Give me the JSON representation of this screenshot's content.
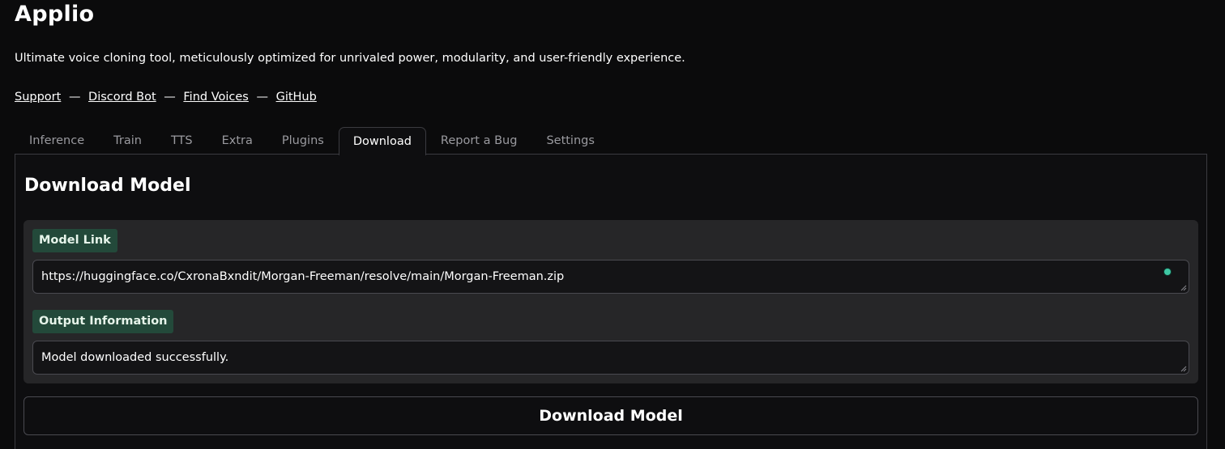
{
  "app": {
    "title": "Applio",
    "tagline": "Ultimate voice cloning tool, meticulously optimized for unrivaled power, modularity, and user-friendly experience."
  },
  "links": {
    "separator": "—",
    "items": [
      {
        "label": "Support"
      },
      {
        "label": "Discord Bot"
      },
      {
        "label": "Find Voices"
      },
      {
        "label": "GitHub"
      }
    ]
  },
  "tabs": [
    {
      "label": "Inference",
      "active": false
    },
    {
      "label": "Train",
      "active": false
    },
    {
      "label": "TTS",
      "active": false
    },
    {
      "label": "Extra",
      "active": false
    },
    {
      "label": "Plugins",
      "active": false
    },
    {
      "label": "Download",
      "active": true
    },
    {
      "label": "Report a Bug",
      "active": false
    },
    {
      "label": "Settings",
      "active": false
    }
  ],
  "download": {
    "heading": "Download Model",
    "model_link": {
      "label": "Model Link",
      "value": "https://huggingface.co/CxronaBxndit/Morgan-Freeman/resolve/main/Morgan-Freeman.zip"
    },
    "output": {
      "label": "Output Information",
      "value": "Model downloaded successfully."
    },
    "button_label": "Download Model"
  },
  "colors": {
    "background": "#0b0b0c",
    "label_chip": "#23493a",
    "status_dot": "#3ec7a3"
  }
}
